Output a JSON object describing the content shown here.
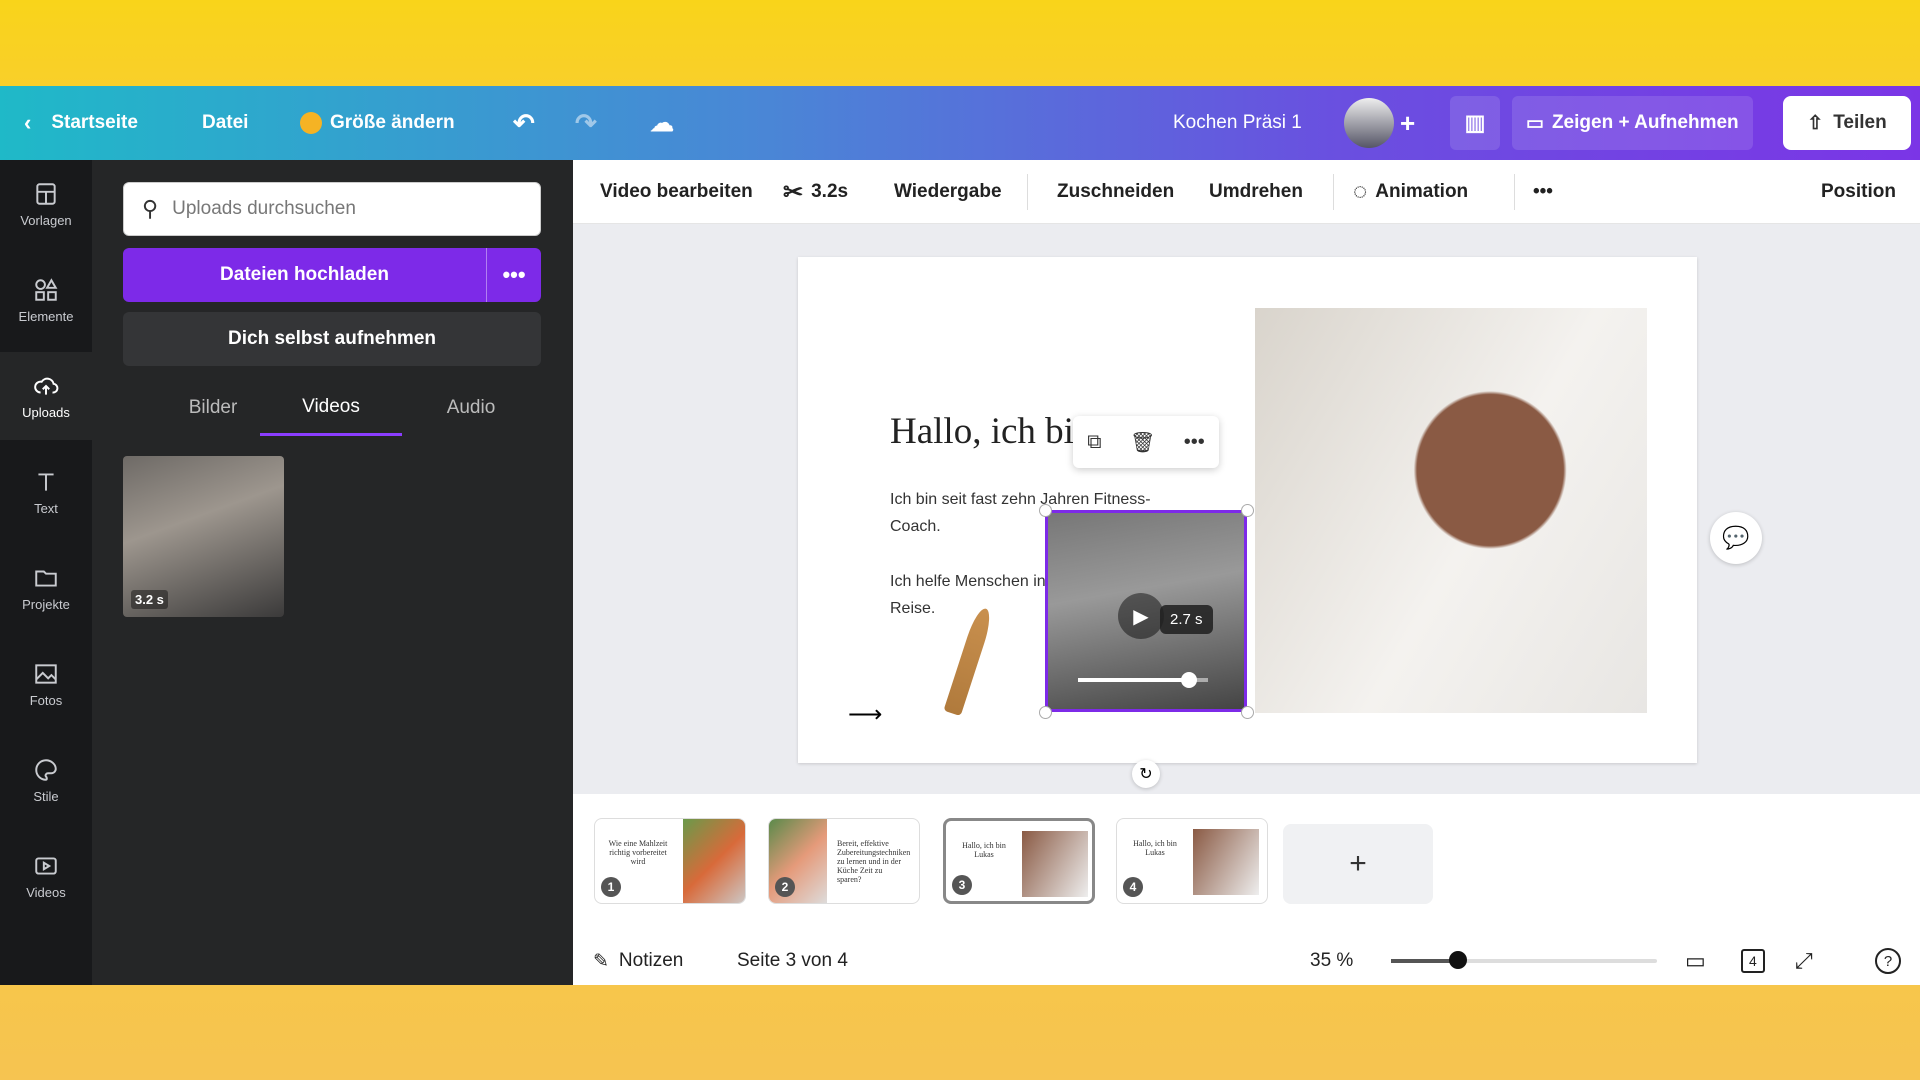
{
  "topbar": {
    "home": "Startseite",
    "file": "Datei",
    "resize": "Größe ändern",
    "title": "Kochen Präsi 1",
    "present": "Zeigen + Aufnehmen",
    "share": "Teilen"
  },
  "rail": [
    {
      "label": "Vorlagen",
      "icon": "template-icon"
    },
    {
      "label": "Elemente",
      "icon": "shapes-icon"
    },
    {
      "label": "Uploads",
      "icon": "cloud-upload-icon"
    },
    {
      "label": "Text",
      "icon": "text-icon"
    },
    {
      "label": "Projekte",
      "icon": "folder-icon"
    },
    {
      "label": "Fotos",
      "icon": "image-icon"
    },
    {
      "label": "Stile",
      "icon": "palette-icon"
    },
    {
      "label": "Videos",
      "icon": "video-icon"
    }
  ],
  "panel": {
    "search_placeholder": "Uploads durchsuchen",
    "upload": "Dateien hochladen",
    "record": "Dich selbst aufnehmen",
    "tabs": [
      "Bilder",
      "Videos",
      "Audio"
    ],
    "active_tab": "Videos",
    "video_duration": "3.2 s"
  },
  "toolbar": {
    "edit_video": "Video bearbeiten",
    "trim": "3.2s",
    "playback": "Wiedergabe",
    "crop": "Zuschneiden",
    "flip": "Umdrehen",
    "animation": "Animation",
    "position": "Position"
  },
  "slide": {
    "heading": "Hallo, ich bin",
    "para1": "Ich bin seit fast zehn Jahren Fitness-Coach.",
    "para2": "Ich helfe Menschen in ihrer Wellness-Reise.",
    "video_time": "2.7 s",
    "video_progress": 0.85
  },
  "pages": [
    {
      "n": "1",
      "text": "Wie eine Mahlzeit richtig vorbereitet wird"
    },
    {
      "n": "2",
      "text": "Bereit, effektive Zubereitungstechniken zu lernen und in der Küche Zeit zu sparen?"
    },
    {
      "n": "3",
      "text": "Hallo, ich bin Lukas"
    },
    {
      "n": "4",
      "text": "Hallo, ich bin Lukas"
    }
  ],
  "footer": {
    "notes": "Notizen",
    "page": "Seite 3 von 4",
    "zoom": "35 %",
    "zoom_value": 35,
    "page_count": "4"
  },
  "colors": {
    "accent": "#7d2ae8"
  }
}
